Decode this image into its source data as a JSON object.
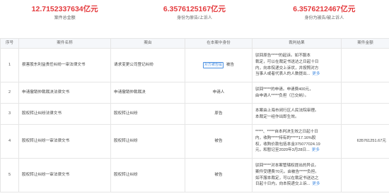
{
  "stats": [
    {
      "value": "12.7152337634亿元",
      "label": "案件总金额"
    },
    {
      "value": "6.3576125167亿元",
      "label": "身份为原告/上诉人"
    },
    {
      "value": "6.3576212467亿元",
      "label": "身份为被告/被上诉人"
    }
  ],
  "table": {
    "headers": [
      "序号",
      "案件名称",
      "案由",
      "在本案中身份",
      "裁判结果",
      "案件金额"
    ],
    "rows": [
      {
        "index": "1",
        "name": "损害股东利益责任纠纷一审法律文书",
        "cause": "请求变更公司登记纠纷",
        "tag": "对方被告提",
        "role": "被告",
        "result": [
          "驳回原告*****的起诉。如不服本",
          "裁定，可以在裁定书送达之日起十日",
          "内，向本院递交上诉状，并按照对方",
          "当事人或者代表人的人数提出..."
        ],
        "more": "更多",
        "amount": ""
      },
      {
        "index": "2",
        "name": "申请撤销仲裁裁决法律文书",
        "cause": "申请撤销仲裁裁决",
        "tag": "",
        "role": "申请人",
        "result": [
          "驳回*****的申请。申请费400元，",
          "由申请人*****负担（已交纳）。"
        ],
        "more": "",
        "amount": ""
      },
      {
        "index": "3",
        "name": "股权转让纠纷法律文书",
        "cause": "股权转让纠纷",
        "tag": "",
        "role": "原告",
        "result": [
          "本案由上海市闵行区人民法院审理。",
          "本裁定一经作出即生效。"
        ],
        "more": "",
        "amount": ""
      },
      {
        "index": "4",
        "name": "股权转让纠纷一审法律文书",
        "cause": "股权转让纠纷",
        "tag": "",
        "role": "被告",
        "result": [
          "*****、*****自本判决生效之日起十日",
          "内，收购*****持有的*****17.16%股",
          "权，收购价款包括本金375077024.19",
          "元，和暂记至2020年3月28日..."
        ],
        "more": "更多",
        "amount": "635761251.67元"
      },
      {
        "index": "5",
        "name": "股权转让纠纷一审法律文书",
        "cause": "股权转让纠纷",
        "tag": "",
        "role": "被告",
        "result": [
          "驳回*****对本案管辖权提出的异议。",
          "案件受理费70元，由被告*****负担。",
          "如不服本裁定，可以在裁定书送达之",
          "日起十日内，向本院递交上诉..."
        ],
        "more": "更多",
        "amount": ""
      }
    ]
  }
}
